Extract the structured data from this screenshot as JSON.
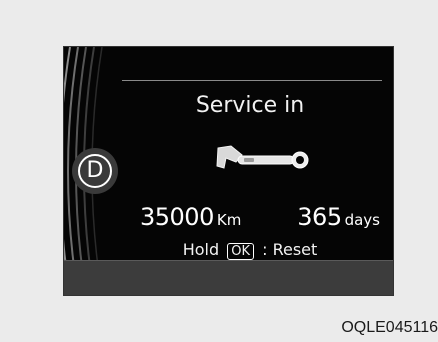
{
  "gear": {
    "label": "D"
  },
  "service": {
    "title": "Service in",
    "distance_value": "35000",
    "distance_unit": "Km",
    "days_value": "365",
    "days_unit": "days"
  },
  "reset": {
    "prefix": "Hold",
    "key_label": "OK",
    "suffix": ": Reset"
  },
  "caption": "OQLE045116",
  "icons": {
    "service": "wrench-icon"
  },
  "colors": {
    "display_background": "#050505",
    "text": "#ffffff",
    "bottom_band": "#3c3c3c",
    "page_background": "#ebebeb"
  }
}
